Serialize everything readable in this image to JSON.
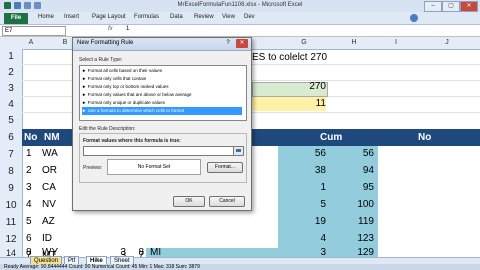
{
  "window": {
    "title": "MrExcelFormulaFun1108.xlsx - Microsoft Excel",
    "controls": [
      "–",
      "▢",
      "✕"
    ]
  },
  "ribbon": {
    "file": "File",
    "tabs": [
      "Home",
      "Insert",
      "Page Layout",
      "Formulas",
      "Data",
      "Review",
      "View",
      "Dev"
    ]
  },
  "formula_bar": {
    "name_box": "E7",
    "fx": "fx",
    "value": "1"
  },
  "columns": [
    "A",
    "B",
    "C",
    "D",
    "E",
    "F",
    "G",
    "H",
    "I",
    "J"
  ],
  "rows": [
    {
      "num": "5",
      "b": "",
      "c": "",
      "e": "",
      "f": "",
      "g": "",
      "h": ""
    },
    {
      "num": "6",
      "a": "No",
      "b": "NM",
      "g": "Cum",
      "j": "No"
    },
    {
      "num": "7",
      "a": "1",
      "b": "WA",
      "g": "",
      "h": "56",
      "f": "56"
    },
    {
      "num": "8",
      "a": "2",
      "b": "OR",
      "h": "94",
      "f": "38"
    },
    {
      "num": "9",
      "a": "3",
      "b": "CA",
      "h": "95",
      "f": "1"
    },
    {
      "num": "10",
      "a": "4",
      "b": "NV",
      "h": "100",
      "f": "5"
    },
    {
      "num": "11",
      "a": "5",
      "b": "AZ",
      "h": "119",
      "f": "19"
    },
    {
      "num": "12",
      "a": "6",
      "b": "ID",
      "h": "123",
      "f": "4"
    },
    {
      "num": "13",
      "a": "7",
      "b": "MT",
      "c": "3",
      "e": "7",
      "ef": "OH",
      "h": "126",
      "f": "3"
    },
    {
      "num": "14",
      "a": "8",
      "b": "WY",
      "c": "3",
      "e": "8",
      "ef": "MI",
      "h": "129",
      "f": "3"
    }
  ],
  "top_cells": {
    "banner": "ES to colelct 270",
    "value_270": "270",
    "value_11": "11",
    "row3": "3",
    "row4": "4",
    "row2": "2",
    "row1": "1"
  },
  "dialog": {
    "title": "New Formatting Rule",
    "help": "?",
    "close": "✕",
    "select_label": "Select a Rule Type:",
    "rules": [
      "► Format all cells based on their values",
      "► Format only cells that contain",
      "► Format only top or bottom ranked values",
      "► Format only values that are above or below average",
      "► Format only unique or duplicate values",
      "► Use a formula to determine which cells to format"
    ],
    "edit_label": "Edit the Rule Description:",
    "formula_label": "Format values where this formula is true:",
    "preview_label": "Preview:",
    "preview_text": "No Format Set",
    "format_button": "Format...",
    "ok": "OK",
    "cancel": "Cancel"
  },
  "sheets": [
    "Question",
    "Ptf",
    "Hike",
    "Sheet"
  ],
  "status": "Ready    Average: 90.8444444    Count: 90    Numerical Count: 45    Min: 1    Max: 318    Sum: 3879"
}
